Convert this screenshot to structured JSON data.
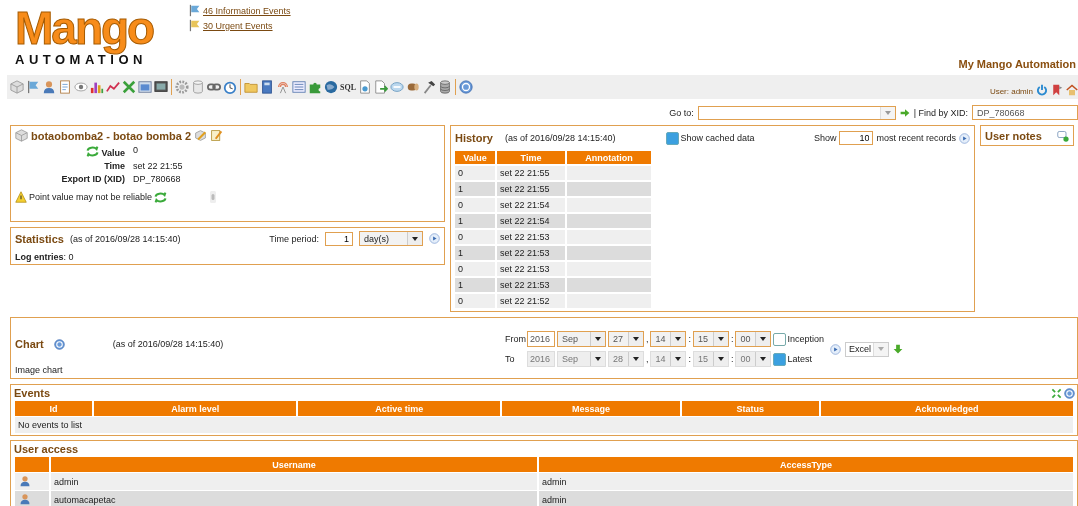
{
  "header": {
    "logo_title": "Mango",
    "logo_subtitle": "AUTOMATION",
    "event_links": [
      {
        "kind": "information",
        "label": "46 Information Events"
      },
      {
        "kind": "urgent",
        "label": "30 Urgent Events"
      }
    ],
    "app_title": "My Mango Automation"
  },
  "toolbar": {
    "sql_label": "SQL",
    "user_label": "User: admin"
  },
  "goto": {
    "label": "Go to:",
    "find_label": "| Find by XID:",
    "find_value": "DP_780668"
  },
  "point": {
    "title": "botaobomba2 - botao bomba 2",
    "fields": [
      {
        "label": "Value",
        "value": "0"
      },
      {
        "label": "Time",
        "value": "set 22 21:55"
      },
      {
        "label": "Export ID (XID)",
        "value": "DP_780668"
      }
    ],
    "warning": "Point value may not be reliable"
  },
  "statistics": {
    "title": "Statistics",
    "as_of": "(as of 2016/09/28 14:15:40)",
    "period_label": "Time period:",
    "period_value": "1",
    "period_unit": "day(s)",
    "log_entries": "**Log entries**: 0"
  },
  "history": {
    "title": "History",
    "as_of": "(as of 2016/09/28 14:15:40)",
    "show_cached": {
      "label": "Show cached data",
      "checked": true
    },
    "show_label": "Show",
    "show_count": "10",
    "show_suffix": "most recent records",
    "columns": [
      "Value",
      "Time",
      "Annotation"
    ],
    "rows": [
      [
        "0",
        "set 22 21:55"
      ],
      [
        "1",
        "set 22 21:55"
      ],
      [
        "0",
        "set 22 21:54"
      ],
      [
        "1",
        "set 22 21:54"
      ],
      [
        "0",
        "set 22 21:53"
      ],
      [
        "1",
        "set 22 21:53"
      ],
      [
        "0",
        "set 22 21:53"
      ],
      [
        "1",
        "set 22 21:53"
      ],
      [
        "0",
        "set 22 21:52"
      ]
    ]
  },
  "user_notes": {
    "title": "User notes"
  },
  "chart": {
    "title": "Chart",
    "as_of": "(as of 2016/09/28 14:15:40)",
    "image_label": "Image chart",
    "range": [
      {
        "label": "From",
        "disabled": false,
        "year": "2016",
        "month": "Sep",
        "day": "27",
        "hour": "14",
        "minute": "15",
        "second": "00",
        "separators": [
          ",",
          ":",
          ":"
        ],
        "option": {
          "label": "Inception",
          "checked": false
        }
      },
      {
        "label": "To",
        "disabled": true,
        "year": "2016",
        "month": "Sep",
        "day": "28",
        "hour": "14",
        "minute": "15",
        "second": "00",
        "separators": [
          ",",
          ":",
          ":"
        ],
        "option": {
          "label": "Latest",
          "checked": true
        }
      }
    ],
    "format": "Excel"
  },
  "events": {
    "title": "Events",
    "columns": [
      "Id",
      "Alarm level",
      "Active time",
      "Message",
      "Status",
      "Acknowledged"
    ],
    "empty": "No events to list"
  },
  "user_access": {
    "title": "User access",
    "columns": [
      "Username",
      "AccessType"
    ],
    "rows": [
      {
        "username": "admin",
        "access": "admin"
      },
      {
        "username": "automacapetac",
        "access": "admin"
      }
    ]
  }
}
